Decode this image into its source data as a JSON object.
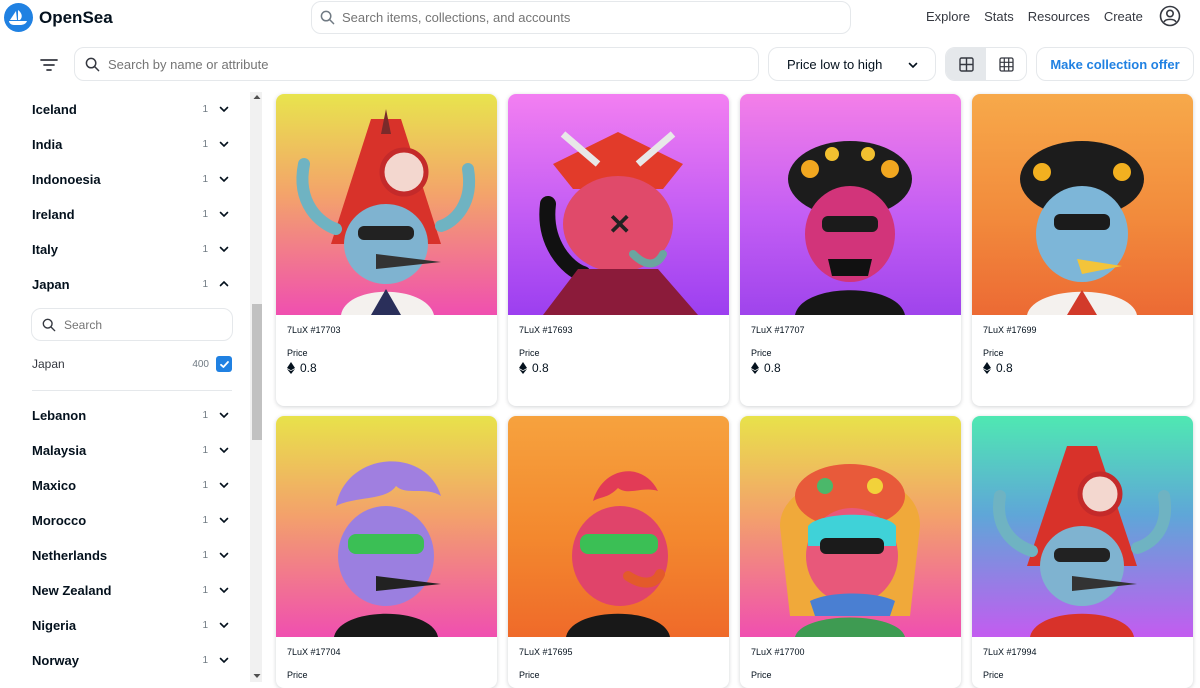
{
  "brand": {
    "name": "OpenSea",
    "accent": "#2081e2"
  },
  "global_search": {
    "placeholder": "Search items, collections, and accounts"
  },
  "nav": {
    "links": [
      "Explore",
      "Stats",
      "Resources",
      "Create"
    ]
  },
  "filterbar": {
    "search_placeholder": "Search by name or attribute",
    "sort_value": "Price low to high",
    "offer_button": "Make collection offer"
  },
  "sidebar": {
    "groups_top": [
      {
        "label": "Iceland",
        "count": "1"
      },
      {
        "label": "India",
        "count": "1"
      },
      {
        "label": "Indonoesia",
        "count": "1"
      },
      {
        "label": "Ireland",
        "count": "1"
      },
      {
        "label": "Italy",
        "count": "1"
      },
      {
        "label": "Japan",
        "count": "1"
      }
    ],
    "expanded": {
      "search_placeholder": "Search",
      "option_label": "Japan",
      "option_count": "400",
      "option_checked": true
    },
    "groups_bottom": [
      {
        "label": "Lebanon",
        "count": "1"
      },
      {
        "label": "Malaysia",
        "count": "1"
      },
      {
        "label": "Maxico",
        "count": "1"
      },
      {
        "label": "Morocco",
        "count": "1"
      },
      {
        "label": "Netherlands",
        "count": "1"
      },
      {
        "label": "New Zealand",
        "count": "1"
      },
      {
        "label": "Nigeria",
        "count": "1"
      },
      {
        "label": "Norway",
        "count": "1"
      }
    ]
  },
  "items": [
    {
      "name": "7LuX #17703",
      "price_label": "Price",
      "price": "0.8"
    },
    {
      "name": "7LuX #17693",
      "price_label": "Price",
      "price": "0.8"
    },
    {
      "name": "7LuX #17707",
      "price_label": "Price",
      "price": "0.8"
    },
    {
      "name": "7LuX #17699",
      "price_label": "Price",
      "price": "0.8"
    },
    {
      "name": "7LuX #17704",
      "price_label": "Price",
      "price": ""
    },
    {
      "name": "7LuX #17695",
      "price_label": "Price",
      "price": ""
    },
    {
      "name": "7LuX #17700",
      "price_label": "Price",
      "price": ""
    },
    {
      "name": "7LuX #17994",
      "price_label": "Price",
      "price": ""
    }
  ]
}
